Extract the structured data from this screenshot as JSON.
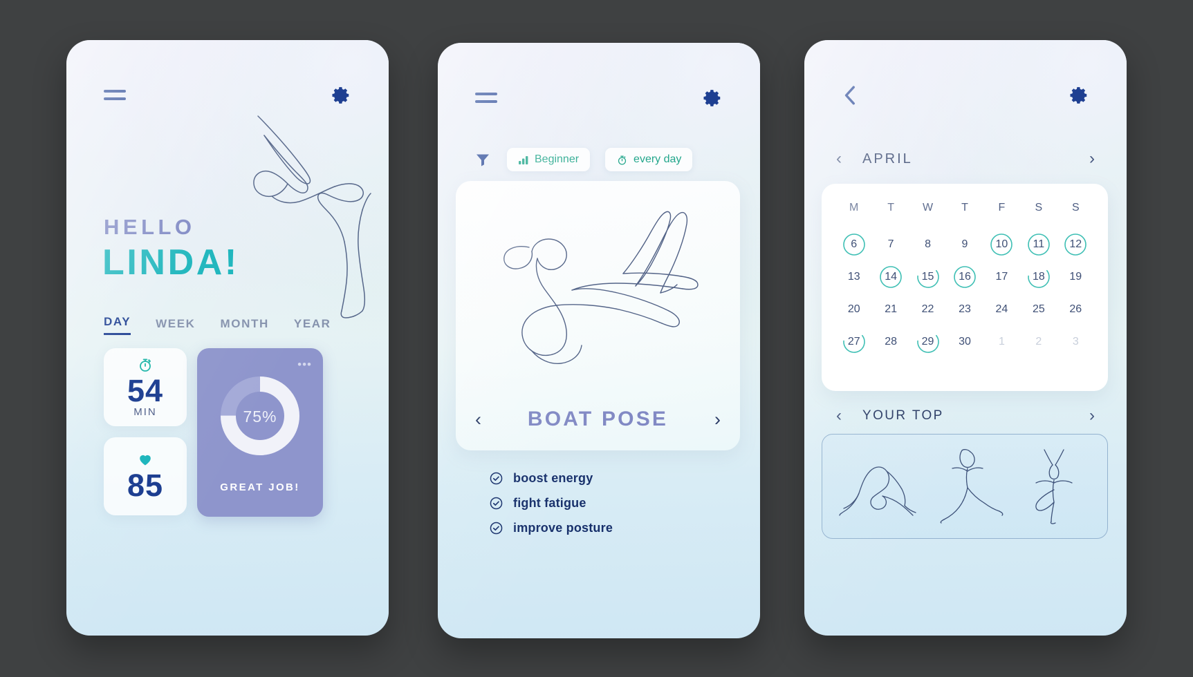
{
  "screen1": {
    "menu_icon": "hamburger-icon",
    "settings_icon": "gear-icon",
    "greeting_small": "HELLO",
    "greeting_name": "LINDA!",
    "tabs": [
      {
        "label": "DAY",
        "active": true
      },
      {
        "label": "WEEK",
        "active": false
      },
      {
        "label": "MONTH",
        "active": false
      },
      {
        "label": "YEAR",
        "active": false
      }
    ],
    "stats": [
      {
        "icon": "stopwatch-icon",
        "value": "54",
        "unit": "MIN"
      },
      {
        "icon": "heart-icon",
        "value": "85",
        "unit": ""
      }
    ],
    "progress": {
      "more_icon": "more-options-icon",
      "percent_label": "75%",
      "percent_value": 75,
      "caption": "GREAT JOB!",
      "fill_color": "#f1f2f9",
      "track_color": "#a4aad8",
      "card_color": "#8e95cc"
    }
  },
  "screen2": {
    "menu_icon": "hamburger-icon",
    "settings_icon": "gear-icon",
    "filter_icon": "filter-funnel-icon",
    "filters": [
      {
        "icon": "bar-levels-icon",
        "label": "Beginner"
      },
      {
        "icon": "stopwatch-icon",
        "label": "every day"
      }
    ],
    "pose": {
      "illustration": "boat-pose-line-art",
      "title": "BOAT POSE",
      "prev_icon": "chevron-left-icon",
      "next_icon": "chevron-right-icon"
    },
    "benefits": [
      {
        "icon": "check-circle-icon",
        "label": "boost energy"
      },
      {
        "icon": "check-circle-icon",
        "label": "fight fatigue"
      },
      {
        "icon": "check-circle-icon",
        "label": "improve posture"
      }
    ]
  },
  "screen3": {
    "back_icon": "chevron-left-icon",
    "settings_icon": "gear-icon",
    "month": "APRIL",
    "month_prev_icon": "chevron-left-icon",
    "month_next_icon": "chevron-right-icon",
    "weekday_headers": [
      "M",
      "T",
      "W",
      "T",
      "F",
      "S",
      "S"
    ],
    "accent_color": "#3ebfb4",
    "days": [
      {
        "label": "6",
        "mark": "full",
        "muted": false
      },
      {
        "label": "7",
        "mark": "none",
        "muted": false
      },
      {
        "label": "8",
        "mark": "none",
        "muted": false
      },
      {
        "label": "9",
        "mark": "none",
        "muted": false
      },
      {
        "label": "10",
        "mark": "full",
        "muted": false
      },
      {
        "label": "11",
        "mark": "full",
        "muted": false
      },
      {
        "label": "12",
        "mark": "full",
        "muted": false
      },
      {
        "label": "13",
        "mark": "none",
        "muted": false
      },
      {
        "label": "14",
        "mark": "full",
        "muted": false
      },
      {
        "label": "15",
        "mark": "partial",
        "muted": false
      },
      {
        "label": "16",
        "mark": "full",
        "muted": false
      },
      {
        "label": "17",
        "mark": "none",
        "muted": false
      },
      {
        "label": "18",
        "mark": "partial",
        "muted": false
      },
      {
        "label": "19",
        "mark": "none",
        "muted": false
      },
      {
        "label": "20",
        "mark": "none",
        "muted": false
      },
      {
        "label": "21",
        "mark": "none",
        "muted": false
      },
      {
        "label": "22",
        "mark": "none",
        "muted": false
      },
      {
        "label": "23",
        "mark": "none",
        "muted": false
      },
      {
        "label": "24",
        "mark": "none",
        "muted": false
      },
      {
        "label": "25",
        "mark": "none",
        "muted": false
      },
      {
        "label": "26",
        "mark": "none",
        "muted": false
      },
      {
        "label": "27",
        "mark": "partial",
        "muted": false
      },
      {
        "label": "28",
        "mark": "none",
        "muted": false
      },
      {
        "label": "29",
        "mark": "partial",
        "muted": false
      },
      {
        "label": "30",
        "mark": "none",
        "muted": false
      },
      {
        "label": "1",
        "mark": "none",
        "muted": true
      },
      {
        "label": "2",
        "mark": "none",
        "muted": true
      },
      {
        "label": "3",
        "mark": "none",
        "muted": true
      }
    ],
    "top_section": {
      "label": "YOUR TOP",
      "prev_icon": "chevron-left-icon",
      "next_icon": "chevron-right-icon",
      "poses": [
        "downward-dog-line-art",
        "warrior-pose-line-art",
        "tree-pose-line-art"
      ]
    }
  }
}
